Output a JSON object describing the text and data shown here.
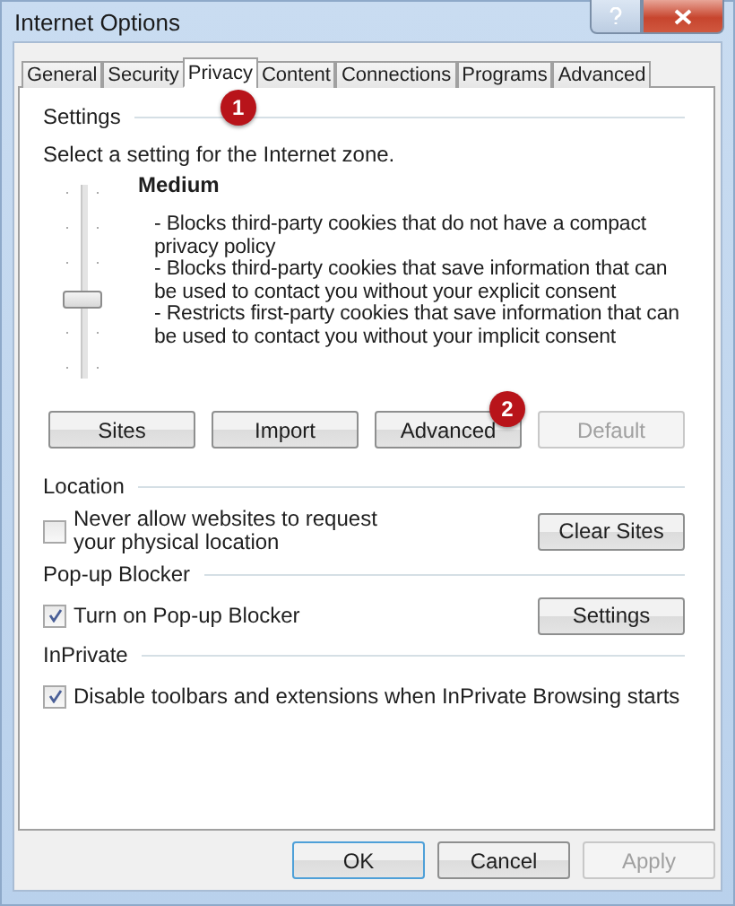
{
  "window": {
    "title": "Internet Options"
  },
  "tabs": [
    {
      "label": "General",
      "selected": false
    },
    {
      "label": "Security",
      "selected": false
    },
    {
      "label": "Privacy",
      "selected": true,
      "badge": "1"
    },
    {
      "label": "Content",
      "selected": false
    },
    {
      "label": "Connections",
      "selected": false
    },
    {
      "label": "Programs",
      "selected": false
    },
    {
      "label": "Advanced",
      "selected": false
    }
  ],
  "settings": {
    "heading": "Settings",
    "prompt": "Select a setting for the Internet zone.",
    "slider": {
      "level": 0.4
    },
    "level_name": "Medium",
    "description": [
      "- Blocks third-party cookies that do not have a compact privacy policy",
      "- Blocks third-party cookies that save information that can be used to contact you without your explicit consent",
      "- Restricts first-party cookies that save information that can be used to contact you without your implicit consent"
    ],
    "buttons": [
      {
        "label": "Sites",
        "disabled": false
      },
      {
        "label": "Import",
        "disabled": false
      },
      {
        "label": "Advanced",
        "disabled": false,
        "badge": "2"
      },
      {
        "label": "Default",
        "disabled": true
      }
    ]
  },
  "sections": [
    {
      "heading": "Location",
      "option": {
        "label": "Never allow websites to request your physical location",
        "checked": false
      },
      "button": "Clear Sites"
    },
    {
      "heading": "Pop-up Blocker",
      "option": {
        "label": "Turn on Pop-up Blocker",
        "checked": true
      },
      "button": "Settings"
    },
    {
      "heading": "InPrivate",
      "option": {
        "label": "Disable toolbars and extensions when InPrivate Browsing starts",
        "checked": true
      }
    }
  ],
  "footer": [
    {
      "label": "OK",
      "default": true,
      "disabled": false
    },
    {
      "label": "Cancel",
      "default": false,
      "disabled": false
    },
    {
      "label": "Apply",
      "default": false,
      "disabled": true
    }
  ]
}
